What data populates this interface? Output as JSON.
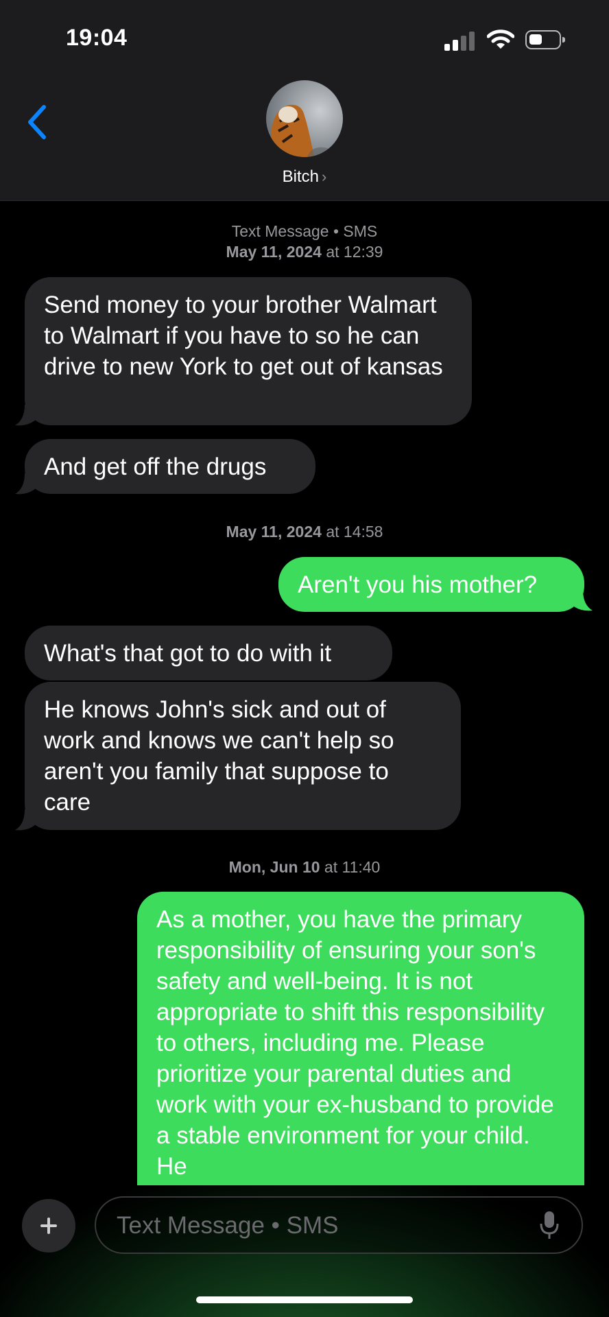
{
  "status": {
    "time": "19:04"
  },
  "header": {
    "contact_name": "Bitch",
    "chevron": "›"
  },
  "conversation": {
    "service_label": "Text Message • SMS",
    "timestamps": [
      {
        "day": "May 11, 2024",
        "at": " at ",
        "time": "12:39"
      },
      {
        "day": "May 11, 2024",
        "at": " at ",
        "time": "14:58"
      },
      {
        "day": "Mon, Jun 10",
        "at": " at ",
        "time": "11:40"
      }
    ],
    "messages": [
      {
        "direction": "incoming",
        "text": "Send money to your brother Walmart to Walmart if you have to so he can drive to new York to get out of kansas"
      },
      {
        "direction": "incoming",
        "text": "And get off the drugs"
      },
      {
        "direction": "outgoing",
        "text": "Aren't you his mother?"
      },
      {
        "direction": "incoming",
        "text": "What's that got to do with it"
      },
      {
        "direction": "incoming",
        "text": "He knows John's sick and out of work and knows we can't help so aren't you family that suppose to care"
      },
      {
        "direction": "outgoing",
        "text": "As a mother, you have the primary responsibility of ensuring your son's safety and well-being. It is not appropriate to shift this responsibility to others, including me. Please prioritize your parental duties and work with your ex-husband to provide a stable environment for your child. He"
      }
    ]
  },
  "compose": {
    "placeholder": "Text Message • SMS"
  },
  "colors": {
    "outgoing_bubble": "#3ddc5c",
    "incoming_bubble": "#262628",
    "accent": "#0a84ff"
  },
  "icons": [
    "back-chevron-icon",
    "signal-icon",
    "wifi-icon",
    "battery-icon",
    "plus-icon",
    "microphone-icon"
  ]
}
